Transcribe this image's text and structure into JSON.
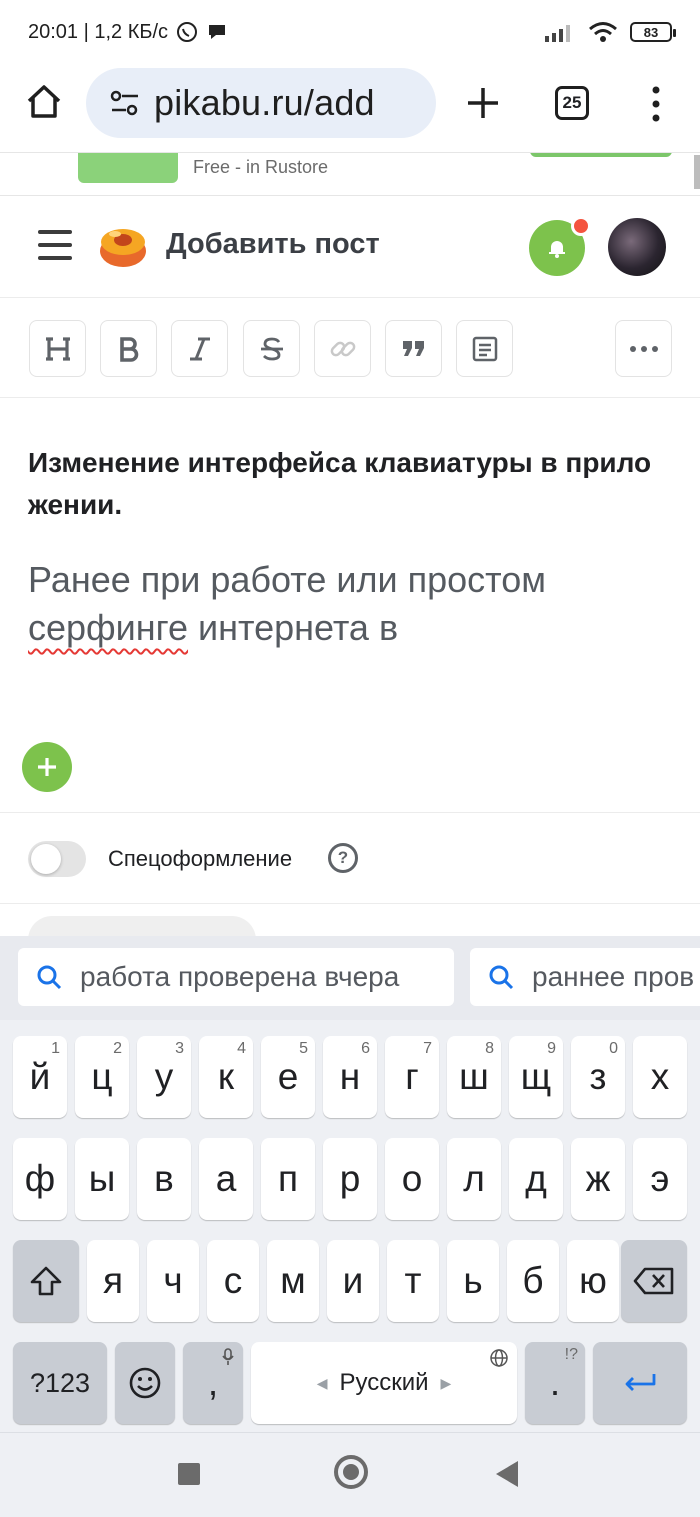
{
  "status_bar": {
    "time_speed": "20:01 | 1,2 КБ/с",
    "battery": "83"
  },
  "browser": {
    "url": "pikabu.ru/add",
    "tab_count": "25"
  },
  "ad": {
    "text": "Free - in Rustore"
  },
  "site_header": {
    "title": "Добавить пост"
  },
  "editor": {
    "title": "Изменение интерфейса клавиатуры  в приложении.",
    "body_part1": "Ранее при работе или простом",
    "body_misspelled": "серфинге",
    "body_part2": " интернета в"
  },
  "special_formatting": {
    "label": "Спецоформление",
    "help": "?"
  },
  "keyboard": {
    "suggestions": [
      "работа проверена вчера",
      "раннее пров"
    ],
    "row1": [
      {
        "char": "й",
        "hint": "1"
      },
      {
        "char": "ц",
        "hint": "2"
      },
      {
        "char": "у",
        "hint": "3"
      },
      {
        "char": "к",
        "hint": "4"
      },
      {
        "char": "е",
        "hint": "5"
      },
      {
        "char": "н",
        "hint": "6"
      },
      {
        "char": "г",
        "hint": "7"
      },
      {
        "char": "ш",
        "hint": "8"
      },
      {
        "char": "щ",
        "hint": "9"
      },
      {
        "char": "з",
        "hint": "0"
      },
      {
        "char": "х",
        "hint": ""
      }
    ],
    "row2": [
      "ф",
      "ы",
      "в",
      "а",
      "п",
      "р",
      "о",
      "л",
      "д",
      "ж",
      "э"
    ],
    "row3": [
      "я",
      "ч",
      "с",
      "м",
      "и",
      "т",
      "ь",
      "б",
      "ю"
    ],
    "symbols_key": "?123",
    "comma_key": ",",
    "space_label": "Русский",
    "period_key": ".",
    "period_hint": "!?",
    "accent_color": "#1a73e8"
  },
  "colors": {
    "brand_green": "#7dc24c",
    "notification_red": "#f4543f"
  }
}
